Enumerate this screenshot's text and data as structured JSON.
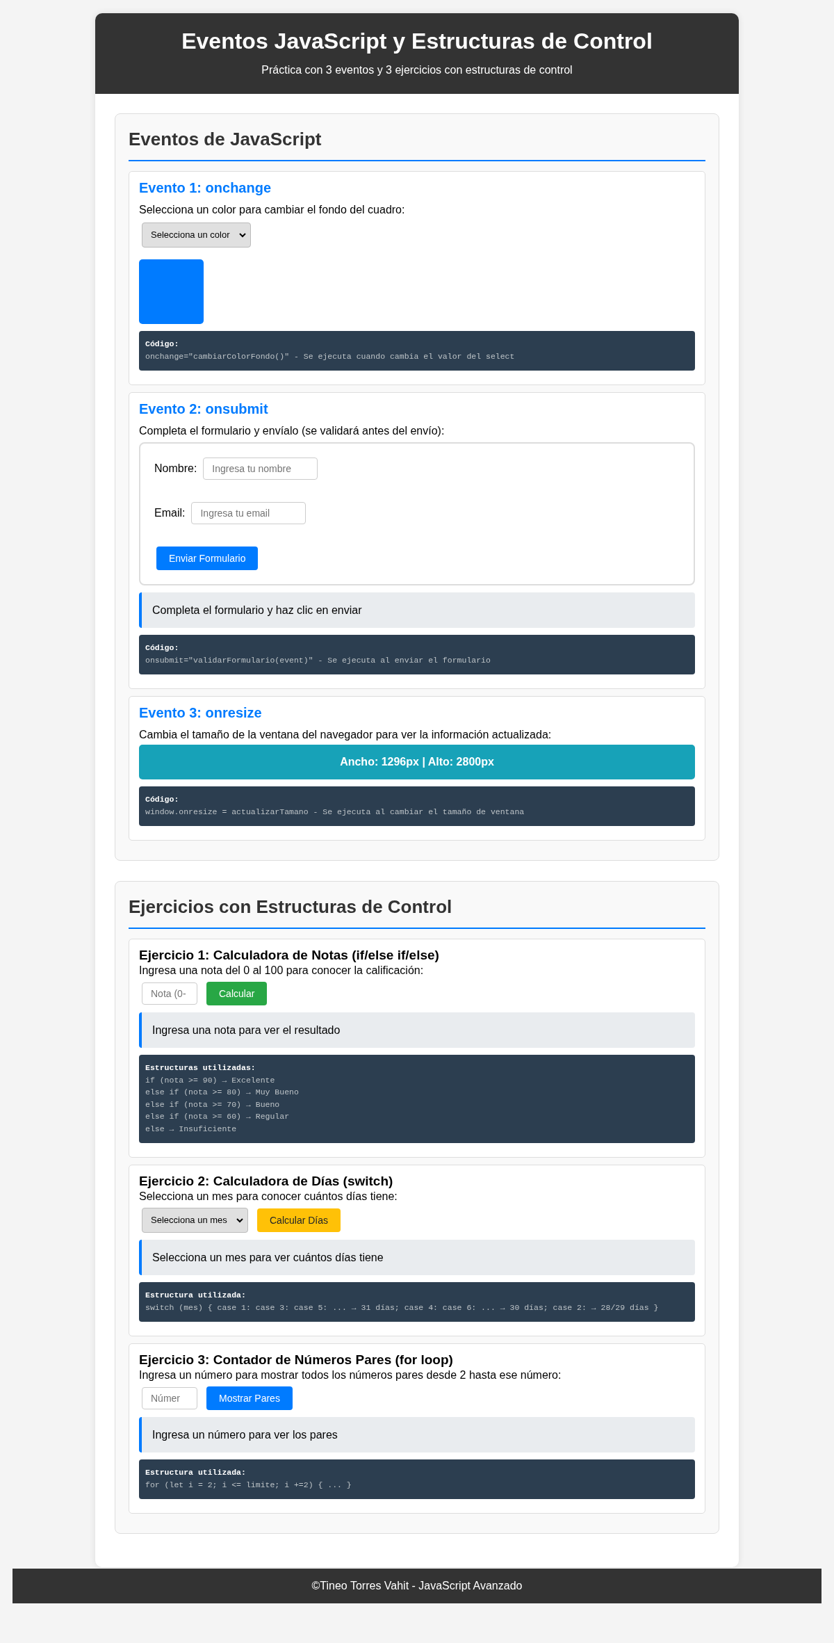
{
  "header": {
    "title": "Eventos JavaScript y Estructuras de Control",
    "subtitle": "Práctica con 3 eventos y 3 ejercicios con estructuras de control"
  },
  "sections": [
    {
      "title": "Eventos de JavaScript",
      "cards": [
        {
          "kind": "event",
          "title": "Evento 1: onchange",
          "blocks": [
            {
              "kind": "text",
              "text": "Selecciona un color para cambiar el fondo del cuadro:"
            },
            {
              "kind": "select",
              "value": "Selecciona un color"
            },
            {
              "kind": "color_box",
              "color": "#007bff"
            },
            {
              "kind": "code",
              "heading": "Código:",
              "lines": [
                "onchange=\"cambiarColorFondo()\" - Se ejecuta cuando cambia el valor del select"
              ]
            }
          ]
        },
        {
          "kind": "event",
          "title": "Evento 2: onsubmit",
          "blocks": [
            {
              "kind": "text",
              "text": "Completa el formulario y envíalo (se validará antes del envío):"
            },
            {
              "kind": "form",
              "fields": [
                {
                  "label": "Nombre:",
                  "placeholder": "Ingresa tu nombre"
                },
                {
                  "label": "Email:",
                  "placeholder": "Ingresa tu email"
                }
              ],
              "button": "Enviar Formulario"
            },
            {
              "kind": "message",
              "text": "Completa el formulario y haz clic en enviar"
            },
            {
              "kind": "code",
              "heading": "Código:",
              "lines": [
                "onsubmit=\"validarFormulario(event)\" - Se ejecuta al enviar el formulario"
              ]
            }
          ]
        },
        {
          "kind": "event",
          "title": "Evento 3: onresize",
          "blocks": [
            {
              "kind": "text",
              "text": "Cambia el tamaño de la ventana del navegador para ver la información actualizada:"
            },
            {
              "kind": "size_display",
              "text": "Ancho: 1296px | Alto: 2800px"
            },
            {
              "kind": "code",
              "heading": "Código:",
              "lines": [
                "window.onresize = actualizarTamano - Se ejecuta al cambiar el tamaño de ventana"
              ]
            }
          ]
        }
      ]
    },
    {
      "title": "Ejercicios con Estructuras de Control",
      "cards": [
        {
          "kind": "exercise",
          "title": "Ejercicio 1: Calculadora de Notas (if/else if/else)",
          "blocks": [
            {
              "kind": "text",
              "text": "Ingresa una nota del 0 al 100 para conocer la calificación:"
            },
            {
              "kind": "controls",
              "input": {
                "kind": "input",
                "placeholder": "Nota (0-"
              },
              "button": {
                "label": "Calcular"
              }
            },
            {
              "kind": "message",
              "text": "Ingresa una nota para ver el resultado"
            },
            {
              "kind": "code",
              "heading": "Estructuras utilizadas:",
              "lines": [
                "if (nota >= 90) → Excelente",
                "else if (nota >= 80) → Muy Bueno",
                "else if (nota >= 70) → Bueno",
                "else if (nota >= 60) → Regular",
                "else → Insuficiente"
              ]
            }
          ]
        },
        {
          "kind": "exercise",
          "title": "Ejercicio 2: Calculadora de Días (switch)",
          "blocks": [
            {
              "kind": "text",
              "text": "Selecciona un mes para conocer cuántos días tiene:"
            },
            {
              "kind": "controls",
              "input": {
                "kind": "select",
                "value": "Selecciona un mes"
              },
              "button": {
                "label": "Calcular Días"
              }
            },
            {
              "kind": "message",
              "text": "Selecciona un mes para ver cuántos días tiene"
            },
            {
              "kind": "code",
              "heading": "Estructura utilizada:",
              "lines": [
                "switch (mes) { case 1: case 3: case 5: ... → 31 días; case 4: case 6: ... → 30 días; case 2: → 28/29 días }"
              ]
            }
          ]
        },
        {
          "kind": "exercise",
          "title": "Ejercicio 3: Contador de Números Pares (for loop)",
          "blocks": [
            {
              "kind": "text",
              "text": "Ingresa un número para mostrar todos los números pares desde 2 hasta ese número:"
            },
            {
              "kind": "controls",
              "input": {
                "kind": "input",
                "placeholder": "Númer"
              },
              "button": {
                "label": "Mostrar Pares"
              }
            },
            {
              "kind": "message",
              "text": "Ingresa un número para ver los pares"
            },
            {
              "kind": "code",
              "heading": "Estructura utilizada:",
              "lines": [
                "for (let i = 2; i <= limite; i +=2) { ... }"
              ]
            }
          ]
        }
      ]
    }
  ],
  "footer": "©Tineo Torres Vahit - JavaScript Avanzado"
}
